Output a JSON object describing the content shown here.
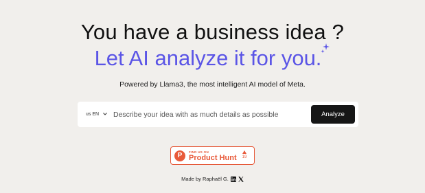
{
  "hero": {
    "title": "You have a business idea ?",
    "subtitle": "Let AI analyze it for you.",
    "sparkle_icon": "sparkle-icon",
    "accent_color": "#5b55e6"
  },
  "tagline": "Powered by Llama3, the most intelligent AI model of Meta.",
  "search": {
    "language": "us EN",
    "placeholder": "Describe your idea with as much details as possible",
    "value": "",
    "button_label": "Analyze"
  },
  "product_hunt": {
    "small_label": "FIND US ON",
    "name": "Product Hunt",
    "logo_letter": "P",
    "upvotes": "19",
    "color": "#e85a3a"
  },
  "footer": {
    "made_by": "Made by Raphaël G.",
    "icons": [
      "linkedin-icon",
      "x-icon"
    ]
  }
}
